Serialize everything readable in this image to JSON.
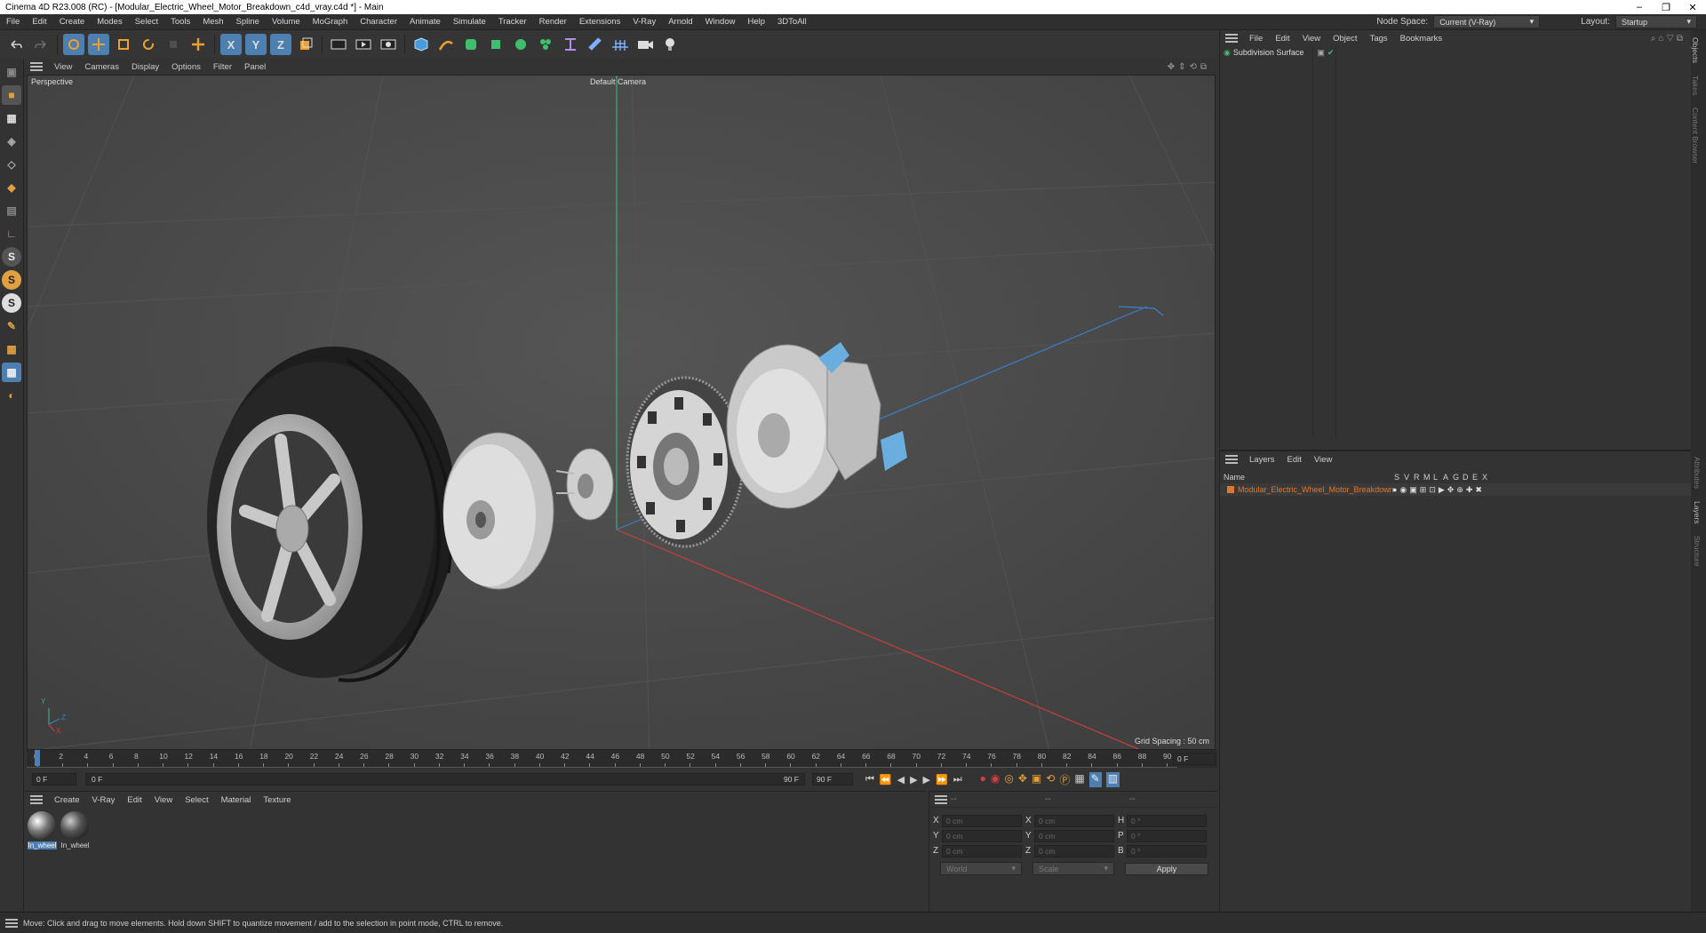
{
  "window": {
    "title": "Cinema 4D R23.008 (RC) - [Modular_Electric_Wheel_Motor_Breakdown_c4d_vray.c4d *] - Main",
    "minimize": "–",
    "maximize": "❐",
    "close": "✕"
  },
  "menubar": {
    "items": [
      "File",
      "Edit",
      "Create",
      "Modes",
      "Select",
      "Tools",
      "Mesh",
      "Spline",
      "Volume",
      "MoGraph",
      "Character",
      "Animate",
      "Simulate",
      "Tracker",
      "Render",
      "Extensions",
      "V-Ray",
      "Arnold",
      "Window",
      "Help",
      "3DToAll"
    ],
    "node_space_label": "Node Space:",
    "node_space_value": "Current (V-Ray)",
    "layout_label": "Layout:",
    "layout_value": "Startup"
  },
  "toolbar": {
    "x_label": "X",
    "y_label": "Y",
    "z_label": "Z"
  },
  "lefttools": {
    "s1": "S",
    "s2": "S",
    "s3": "S"
  },
  "viewport": {
    "menu": [
      "View",
      "Cameras",
      "Display",
      "Options",
      "Filter",
      "Panel"
    ],
    "name": "Perspective",
    "camera": "Default Camera",
    "grid_spacing": "Grid Spacing : 50 cm",
    "axis_y": "Y",
    "axis_z": "Z",
    "axis_x": "X"
  },
  "timeline": {
    "ticks": [
      "0",
      "2",
      "4",
      "6",
      "8",
      "10",
      "12",
      "14",
      "16",
      "18",
      "20",
      "22",
      "24",
      "26",
      "28",
      "30",
      "32",
      "34",
      "36",
      "38",
      "40",
      "42",
      "44",
      "46",
      "48",
      "50",
      "52",
      "54",
      "56",
      "58",
      "60",
      "62",
      "64",
      "66",
      "68",
      "70",
      "72",
      "74",
      "76",
      "78",
      "80",
      "82",
      "84",
      "86",
      "88",
      "90"
    ],
    "end_field": "0 F"
  },
  "transport": {
    "start": "0 F",
    "current": "0 F",
    "range_end": "90 F",
    "end": "90 F"
  },
  "materials": {
    "menu": [
      "Create",
      "V-Ray",
      "Edit",
      "View",
      "Select",
      "Material",
      "Texture"
    ],
    "items": [
      {
        "name": "In_wheel"
      },
      {
        "name": "In_wheel"
      }
    ]
  },
  "coords": {
    "header_a": "--",
    "header_b": "--",
    "header_c": "--",
    "rows": [
      {
        "a": "X",
        "av": "0 cm",
        "b": "X",
        "bv": "0 cm",
        "c": "H",
        "cv": "0 °"
      },
      {
        "a": "Y",
        "av": "0 cm",
        "b": "Y",
        "bv": "0 cm",
        "c": "P",
        "cv": "0 °"
      },
      {
        "a": "Z",
        "av": "0 cm",
        "b": "Z",
        "bv": "0 cm",
        "c": "B",
        "cv": "0 °"
      }
    ],
    "mode1": "World",
    "mode2": "Scale",
    "apply": "Apply"
  },
  "objects": {
    "menu": [
      "File",
      "Edit",
      "View",
      "Object",
      "Tags",
      "Bookmarks"
    ],
    "items": [
      {
        "name": "Subdivision Surface"
      }
    ]
  },
  "layers": {
    "menu": [
      "Layers",
      "Edit",
      "View"
    ],
    "col_name": "Name",
    "col_flags": [
      "S",
      "V",
      "R",
      "M",
      "L",
      "A",
      "G",
      "D",
      "E",
      "X"
    ],
    "items": [
      {
        "name": "Modular_Electric_Wheel_Motor_Breakdown",
        "color": "#e0772e"
      }
    ]
  },
  "sidetabs": [
    "Objects",
    "Takes",
    "Content Browser",
    "Attributes",
    "Layers",
    "Structure"
  ],
  "status": "Move: Click and drag to move elements. Hold down SHIFT to quantize movement / add to the selection in point mode, CTRL to remove.",
  "colors": {
    "accent": "#4d7fb1",
    "layer_orange": "#e0772e",
    "green_axis": "#3fae7a",
    "red_axis": "#c8403a",
    "blue_axis": "#3a7fc8"
  }
}
